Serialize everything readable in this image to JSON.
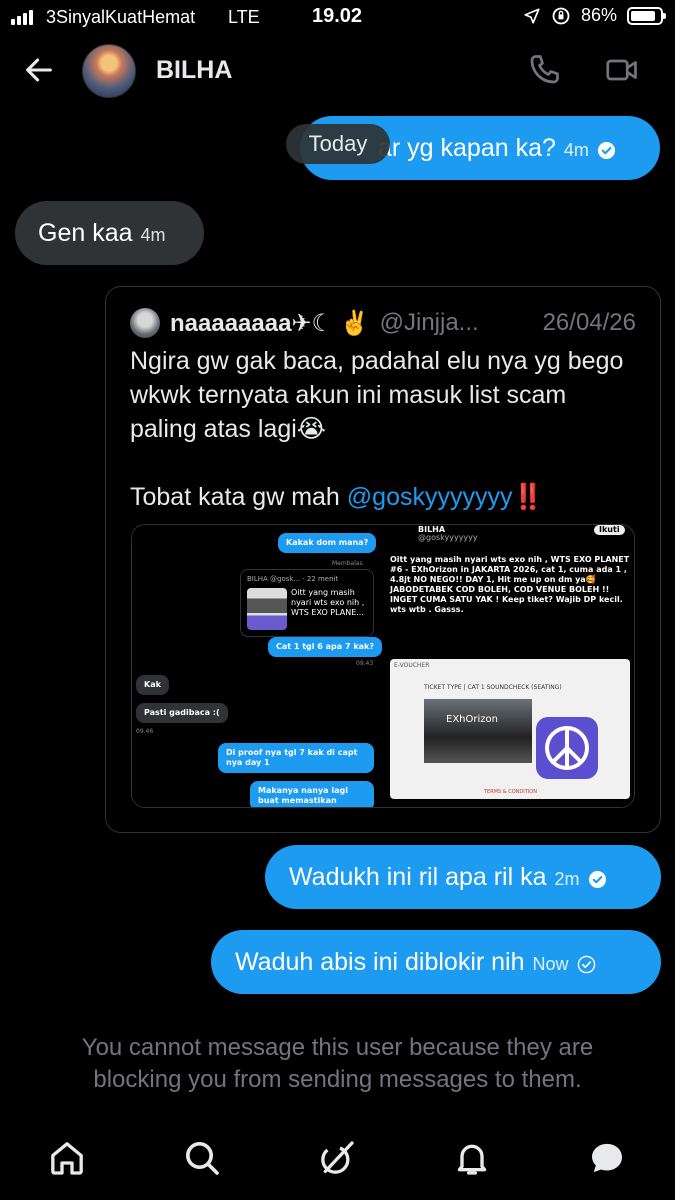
{
  "status_bar": {
    "carrier": "3SinyalKuatHemat",
    "network": "LTE",
    "time": "19.02",
    "battery_pct": "86%",
    "battery_level": 0.86
  },
  "header": {
    "contact_name": "BILHA"
  },
  "date_divider": "Today",
  "messages": [
    {
      "direction": "out",
      "text": "ar yg kapan ka?",
      "time": "4m",
      "status": "read"
    },
    {
      "direction": "in",
      "text": "Gen kaa",
      "time": "4m"
    },
    {
      "direction": "out",
      "text": "Wadukh ini ril apa ril ka",
      "time": "2m",
      "status": "read"
    },
    {
      "direction": "out",
      "text": "Waduh abis ini diblokir nih",
      "time": "Now",
      "status": "sent"
    }
  ],
  "quoted_post": {
    "name": "naaaaaaaa✈☾ ✌️",
    "handle": "@Jinjja...",
    "date": "26/04/26",
    "text_line1": "Ngira gw gak baca, padahal elu nya yg bego wkwk ternyata akun ini masuk list scam paling atas lagi😭",
    "text_line2_prefix": "Tobat kata gw mah ",
    "mention": "@goskyyyyyyy",
    "text_line2_suffix": "‼️",
    "media": {
      "left": {
        "msg1": "Kakak dom mana?",
        "reply_label": "Membalas",
        "quote_name": "BILHA @gosk... · 22 menit",
        "quote_text": "Oitt yang masih nyari wts exo nih , WTS EXO PLANE...",
        "msg2": "Cat 1 tgl 6 apa 7 kak?",
        "time1": "09.43",
        "msg3": "Kak",
        "msg4": "Pasti gadibaca :(",
        "time2": "09.46",
        "msg5": "Di proof nya tgl 7 kak di capt nya day 1",
        "msg6": "Makanya nanya lagi buat memastikan"
      },
      "right": {
        "name": "BILHA",
        "handle": "@goskyyyyyyy",
        "follow": "Ikuti",
        "post": "Oitt yang masih nyari wts exo nih , WTS EXO PLANET #6 - EXhOrizon in JAKARTA 2026, cat 1, cuma ada 1 , 4.8jt NO NEGO!! DAY 1, Hit me up on dm ya🥰 JABODETABEK COD BOLEH, COD VENUE BOLEH !! INGET CUMA SATU YAK ! Keep tiket? Wajib DP kecil. wts wtb . Gasss.",
        "voucher": "E-VOUCHER",
        "ticket_type": "TICKET TYPE | CAT 1 SOUNDCHECK (SEATING)",
        "event_title": "EXhOrizon",
        "terms": "TERMS & CONDITION"
      }
    }
  },
  "blocked_notice": "You cannot message this user because they are blocking you from sending messages to them.",
  "nav": [
    "home",
    "search",
    "grok",
    "notifications",
    "messages"
  ],
  "colors": {
    "accent": "#1d9bf0",
    "incoming_bubble": "#2f3336",
    "muted_text": "#71767b",
    "background": "#000000"
  }
}
